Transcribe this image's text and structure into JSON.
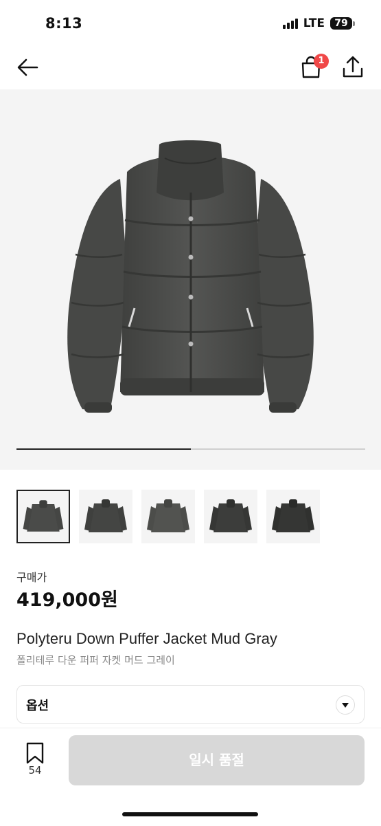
{
  "status": {
    "time": "8:13",
    "network": "LTE",
    "battery": "79"
  },
  "header": {
    "cart_count": "1",
    "icons": [
      "back-arrow-icon",
      "shopping-bag-icon",
      "share-icon"
    ]
  },
  "gallery": {
    "progress": 0.5,
    "thumbnail_count": 5,
    "selected_index": 0
  },
  "product": {
    "price_label": "구매가",
    "price": "419,000원",
    "name_en": "Polyteru Down Puffer Jacket Mud Gray",
    "name_ko": "폴리테루 다운 퍼퍼 자켓 머드 그레이"
  },
  "option": {
    "label": "옵션"
  },
  "bottom": {
    "bookmark_count": "54",
    "cta_label": "일시 품절"
  },
  "colors": {
    "jacket": "#4a4b49",
    "disabled_button": "#d8d8d8",
    "badge": "#f04848"
  }
}
